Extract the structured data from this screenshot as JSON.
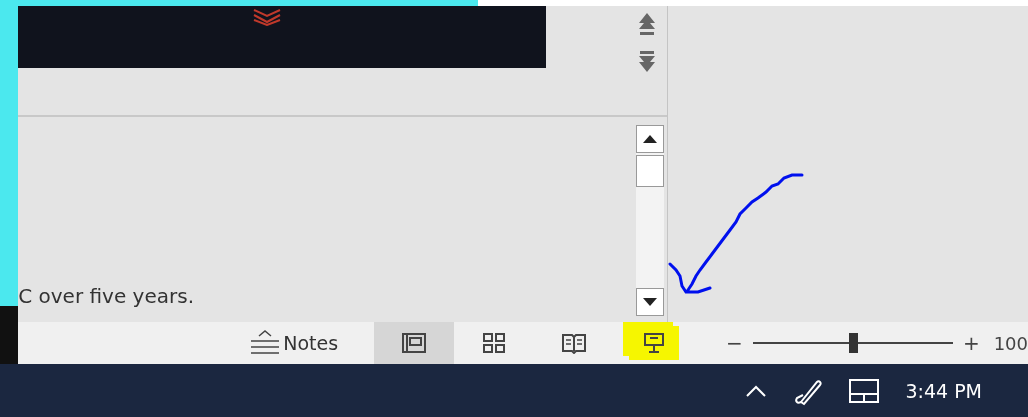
{
  "notes": {
    "text": "C over five years."
  },
  "status_bar": {
    "notes_button": "Notes",
    "views": [
      {
        "kind": "normal",
        "selected": true,
        "highlighted": false
      },
      {
        "kind": "sorter",
        "selected": false,
        "highlighted": false
      },
      {
        "kind": "reading",
        "selected": false,
        "highlighted": false
      },
      {
        "kind": "slideshow",
        "selected": false,
        "highlighted": true
      }
    ],
    "zoom": {
      "minus": "−",
      "plus": "+",
      "level": 0.5,
      "percent": "100"
    }
  },
  "taskbar": {
    "time": "3:44 PM"
  }
}
